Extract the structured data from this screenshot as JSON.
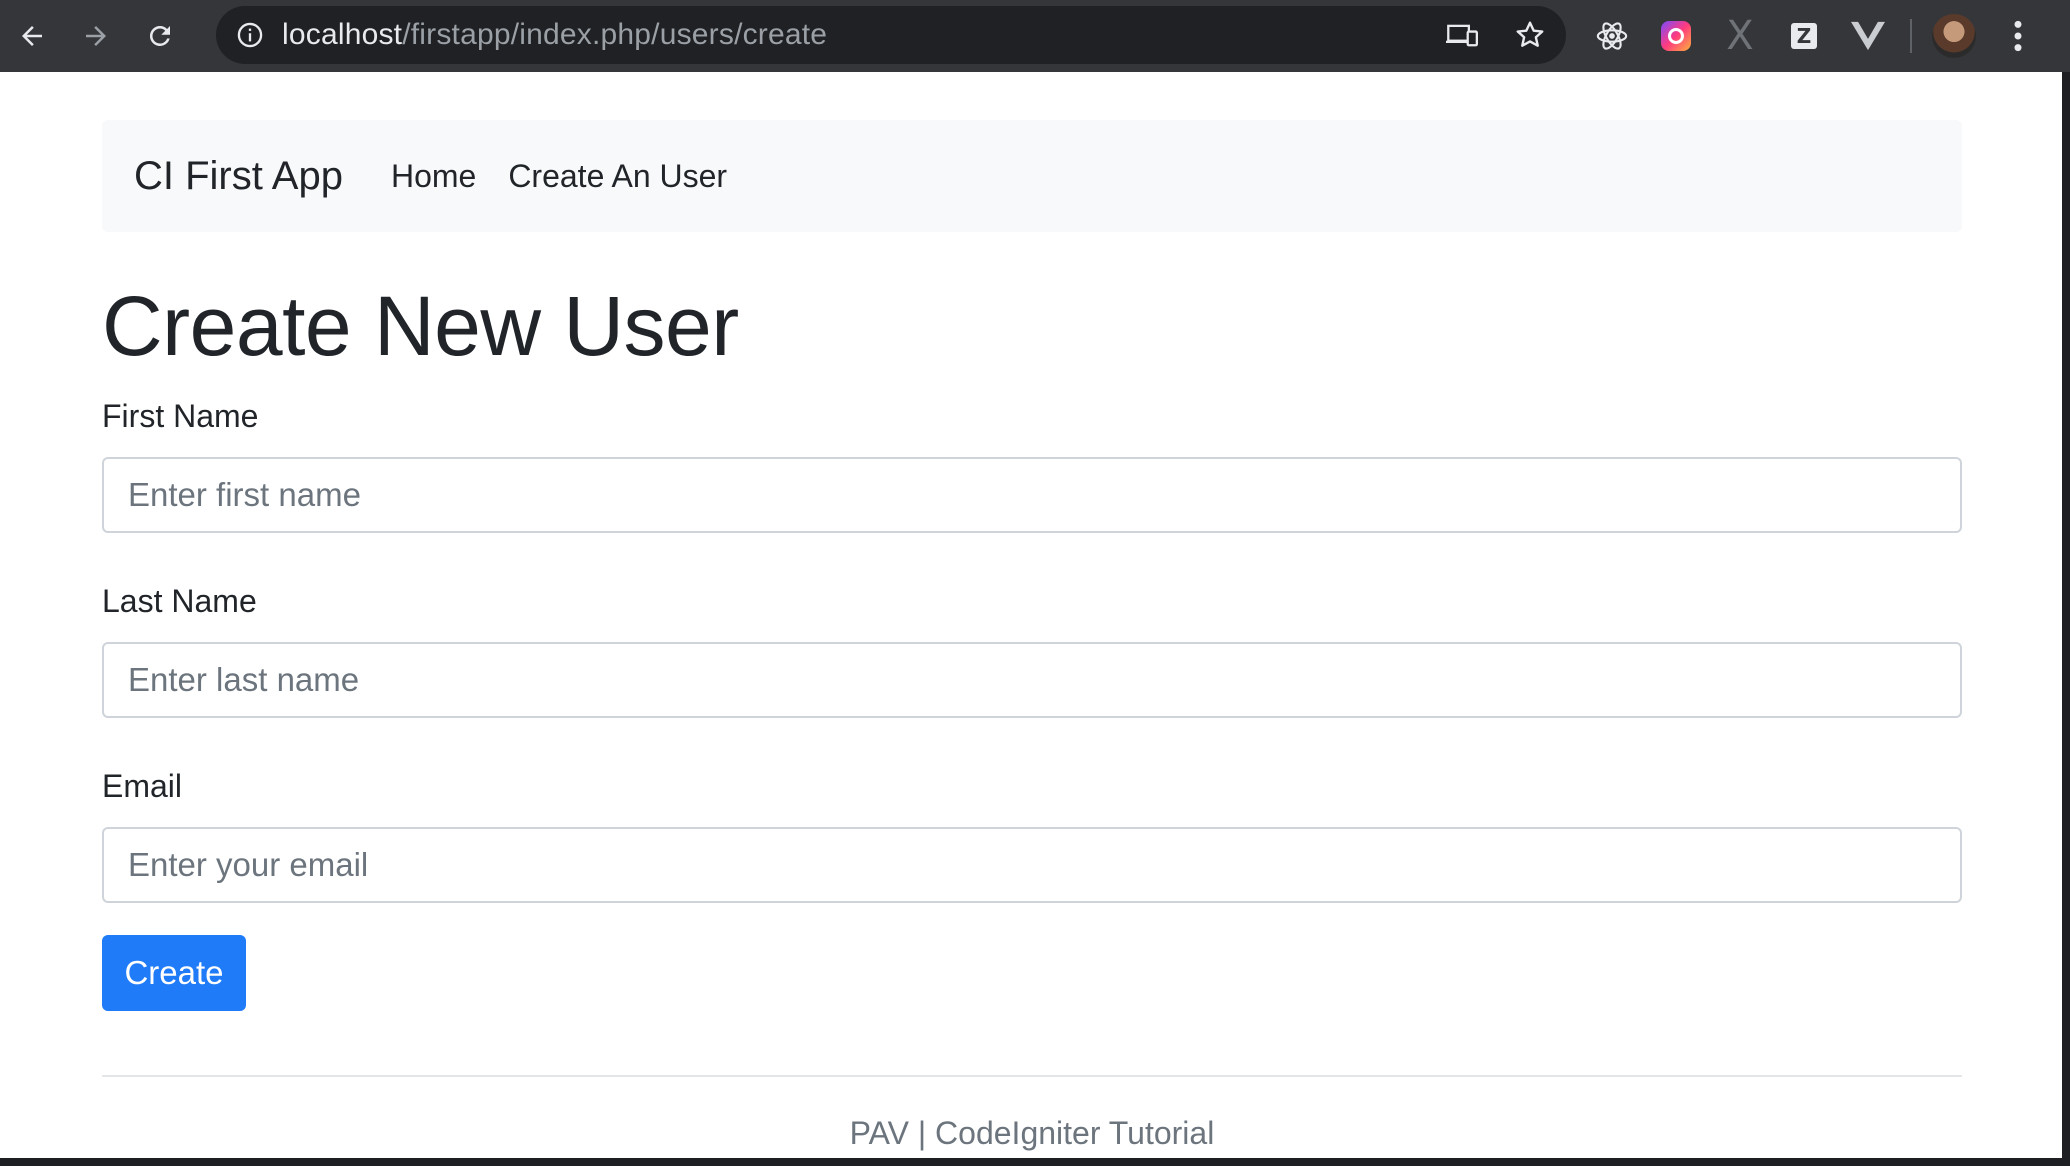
{
  "browser": {
    "url_host": "localhost",
    "url_path": "/firstapp/index.php/users/create",
    "icons": {
      "back": "arrow-left-icon",
      "forward": "arrow-right-icon",
      "reload": "reload-icon",
      "info": "info-icon",
      "devices": "devices-icon",
      "bookmark": "star-icon",
      "react": "react-devtools-icon",
      "instagram": "instagram-icon",
      "x_ext": "x-extension-icon",
      "z_ext": "z-extension-icon",
      "vue": "vue-devtools-icon",
      "profile": "profile-avatar",
      "menu": "kebab-menu-icon"
    },
    "z_letter": "Z",
    "x_letter": "X"
  },
  "navbar": {
    "brand": "CI First App",
    "links": [
      "Home",
      "Create An User"
    ]
  },
  "page": {
    "title": "Create New User",
    "fields": [
      {
        "label": "First Name",
        "placeholder": "Enter first name"
      },
      {
        "label": "Last Name",
        "placeholder": "Enter last name"
      },
      {
        "label": "Email",
        "placeholder": "Enter your email"
      }
    ],
    "submit_label": "Create"
  },
  "footer": {
    "text": "PAV | CodeIgniter Tutorial"
  },
  "colors": {
    "primary": "#1f7bf8",
    "navbar_bg": "#f8f9fa",
    "chrome_bg": "#35363a",
    "omnibox_bg": "#202124"
  }
}
